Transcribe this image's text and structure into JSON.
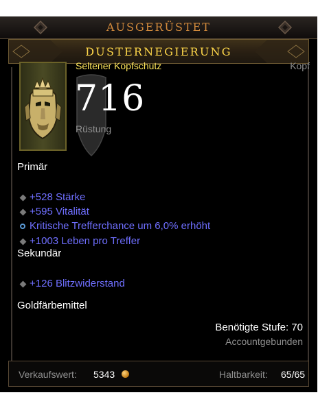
{
  "tooltip": {
    "equipped_label": "AUSGERÜSTET",
    "item_name": "DUSTERNEGIERUNG",
    "item_type": "Seltener Kopfschutz",
    "slot": "Kopf",
    "armor_value": "716",
    "armor_label": "Rüstung",
    "primary_heading": "Primär",
    "primary_affixes": [
      {
        "text": "+528 Stärke",
        "bullet": "diamond"
      },
      {
        "text": "+595 Vitalität",
        "bullet": "diamond"
      },
      {
        "text": "Kritische Trefferchance um 6,0% erhöht",
        "bullet": "ring"
      },
      {
        "text": "+1003 Leben pro Treffer",
        "bullet": "diamond"
      }
    ],
    "secondary_heading": "Sekundär",
    "secondary_affixes": [
      {
        "text": "+126 Blitzwiderstand",
        "bullet": "diamond"
      }
    ],
    "dye": "Goldfärbemittel",
    "required_level": "Benötigte Stufe: 70",
    "binding": "Accountgebunden",
    "sell_label": "Verkaufswert:",
    "sell_value": "5343",
    "durability_label": "Haltbarkeit:",
    "durability_value": "65/65",
    "colors": {
      "rare_yellow": "#ffe65c",
      "magic_blue": "#6f6fff",
      "header_orange": "#d28a3c",
      "muted_gray": "#8f8f8f"
    }
  }
}
